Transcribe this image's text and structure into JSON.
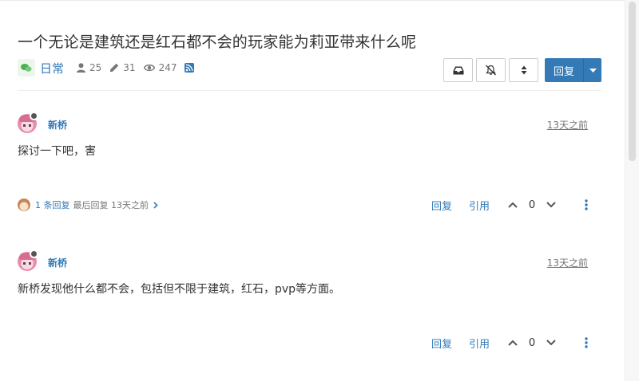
{
  "topic": {
    "title": "一个无论是建筑还是红石都不会的玩家能为莉亚带来什么呢",
    "category": "日常",
    "posters": "25",
    "posts": "31",
    "views": "247"
  },
  "toolbar": {
    "reply_label": "回复"
  },
  "posts": [
    {
      "author": "新桥",
      "time": "13天之前",
      "content": "探讨一下吧，害",
      "replies_count": "1 条回复",
      "last_reply": "最后回复 13天之前",
      "reply_label": "回复",
      "quote_label": "引用",
      "votes": "0"
    },
    {
      "author": "新桥",
      "time": "13天之前",
      "content": "新桥发现他什么都不会，包括但不限于建筑，红石，pvp等方面。",
      "reply_label": "回复",
      "quote_label": "引用",
      "votes": "0"
    }
  ],
  "colors": {
    "primary": "#337ab7",
    "muted": "#777777",
    "text": "#333333",
    "category": "#4caf50"
  }
}
